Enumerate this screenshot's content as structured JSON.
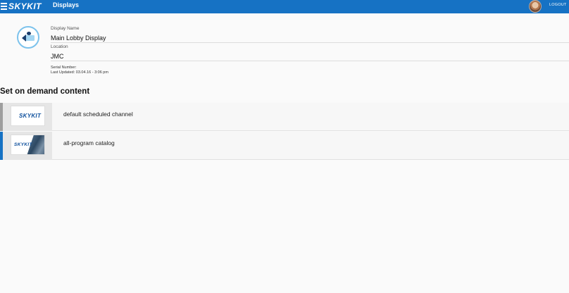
{
  "topbar": {
    "brand": "SKYKIT",
    "title": "Displays",
    "logout_label": "LOGOUT"
  },
  "display": {
    "name_label": "Display Name",
    "name_value": "Main Lobby Display",
    "location_label": "Location",
    "location_value": "JMC",
    "serial_label": "Serial Number:",
    "last_updated": "Last Updated: 03.04.16 - 3:06 pm"
  },
  "content": {
    "section_title": "Set on demand content",
    "items": [
      {
        "label": "default scheduled channel",
        "thumb_text": "SKYKIT",
        "accent": "#9e9e9e"
      },
      {
        "label": "all-program catalog",
        "thumb_text": "SKYKIT",
        "accent": "#1672c4"
      }
    ]
  },
  "colors": {
    "topbar": "#1672c4",
    "icon_ring": "#7cc2ec"
  },
  "icons": [
    "menu-icon",
    "display-icon",
    "avatar"
  ]
}
